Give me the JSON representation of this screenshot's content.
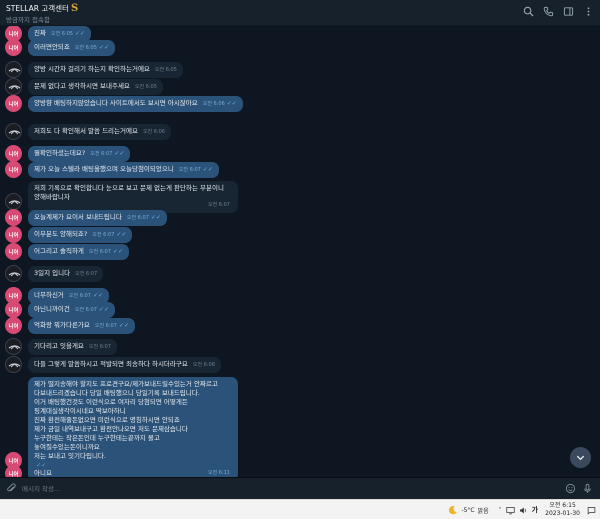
{
  "header": {
    "title": "STELLAR 고객센터",
    "logo_letter": "S",
    "status": "방금까지 접속함"
  },
  "messages": [
    {
      "side": "out",
      "avatar": "user",
      "lines": [
        "진짜"
      ],
      "time": "오전 6:05"
    },
    {
      "side": "out",
      "avatar": "user",
      "lines": [
        "이러면안되죠"
      ],
      "time": "오전 6:05"
    },
    {
      "side": "in",
      "avatar": "stellar",
      "lines": [
        "양방 시간차 걸리기 하는지 확인하는거에요"
      ],
      "time": "오전 6:05"
    },
    {
      "side": "in",
      "avatar": "stellar",
      "lines": [
        "문제 없다고 생각하시면 보내주세요"
      ],
      "time": "오전 6:05"
    },
    {
      "side": "out",
      "avatar": "user",
      "lines": [
        "양방향 배팅하지않았습니다 사이트에서도 보시면 아시잖아요"
      ],
      "time": "오전 6:06"
    },
    {
      "side": "in",
      "avatar": "stellar",
      "lines": [
        "저희도 다 확인해서 말씀 드리는거에요"
      ],
      "time": "오전 6:06"
    },
    {
      "side": "out",
      "avatar": "user",
      "lines": [
        "뭘확인하셨는데요?"
      ],
      "time": "오전 6:07"
    },
    {
      "side": "out",
      "avatar": "user",
      "lines": [
        "제가 오늘 스텔라 배팅올했으며 오늘당첨이되었으니"
      ],
      "time": "오전 6:07"
    },
    {
      "side": "in",
      "avatar": "stellar",
      "lines": [
        "저희 기록으로 확인합니다 눈으로 보고 문제 없는게 판단하는 부분이니",
        "양해바랍니자"
      ],
      "time": "오전 6:07"
    },
    {
      "side": "out",
      "avatar": "user",
      "lines": [
        "오늘계제가 요이서 보내드립니다"
      ],
      "time": "오전 6:07"
    },
    {
      "side": "out",
      "avatar": "user",
      "lines": [
        "이부분도 양해되죠?"
      ],
      "time": "오전 6:07"
    },
    {
      "side": "out",
      "avatar": "user",
      "lines": [
        "어그리고 솔직하게"
      ],
      "time": "오전 6:07"
    },
    {
      "side": "in",
      "avatar": "stellar",
      "lines": [
        "3일지 입니다"
      ],
      "time": "오전 6:07"
    },
    {
      "side": "out",
      "avatar": "user",
      "lines": [
        "너무하신거"
      ],
      "time": "오전 6:07"
    },
    {
      "side": "out",
      "avatar": "user",
      "lines": [
        "아닌니까이건"
      ],
      "time": "오전 6:07"
    },
    {
      "side": "out",
      "avatar": "user",
      "lines": [
        "억화랑 뭐가다른가요"
      ],
      "time": "오전 6:07"
    },
    {
      "side": "in",
      "avatar": "stellar",
      "lines": [
        "기다리고 잇을게요"
      ],
      "time": "오전 6:07"
    },
    {
      "side": "in",
      "avatar": "stellar",
      "lines": [
        "다들 그렇게 말씀하시고 적발되면 죄송하다 하시더라구요"
      ],
      "time": "오전 6:08"
    },
    {
      "side": "out",
      "avatar": "user",
      "lines": [
        "제가 떨지송해야 할지도 프로견구요/제가보내드릴수있는거 안짜르고",
        "다보내드리겠습니다 당일 배팅했으니 당일기록 보내드립니다.",
        "이거 배팅했건것도 이런식으로 여자리 당첨되면 어떻게든",
        "핑계대실생각이시네요 딱보아하니",
        "진짜 환전해줄돈없으면 미런식으로 명칭하시면 안되죠",
        "제가 금일 내역보내구고 환전안나오면 저도 문제삼습니다",
        "누구한테는 작은돈인데 누구한테는끝까지 몰고",
        "놓여질수있는돈이니까요",
        "저는 보내고 잇기다립니다."
      ],
      "time": "오전 6:11"
    },
    {
      "side": "out",
      "avatar": "user",
      "lines": [
        "아니요"
      ],
      "time": ""
    }
  ],
  "avatar_user_label": "니어",
  "composer": {
    "placeholder": "메시지 작성..."
  },
  "taskbar": {
    "temperature": "-5°C",
    "weather": "맑음",
    "language": "가",
    "time": "오전 6:15",
    "date": "2023-01-30"
  },
  "colors": {
    "background": "#0e1621",
    "header": "#17212b",
    "bubble_out": "#2b5278",
    "bubble_in": "#182533",
    "accent": "#6fb1f0",
    "user_avatar": "#d74a73"
  }
}
